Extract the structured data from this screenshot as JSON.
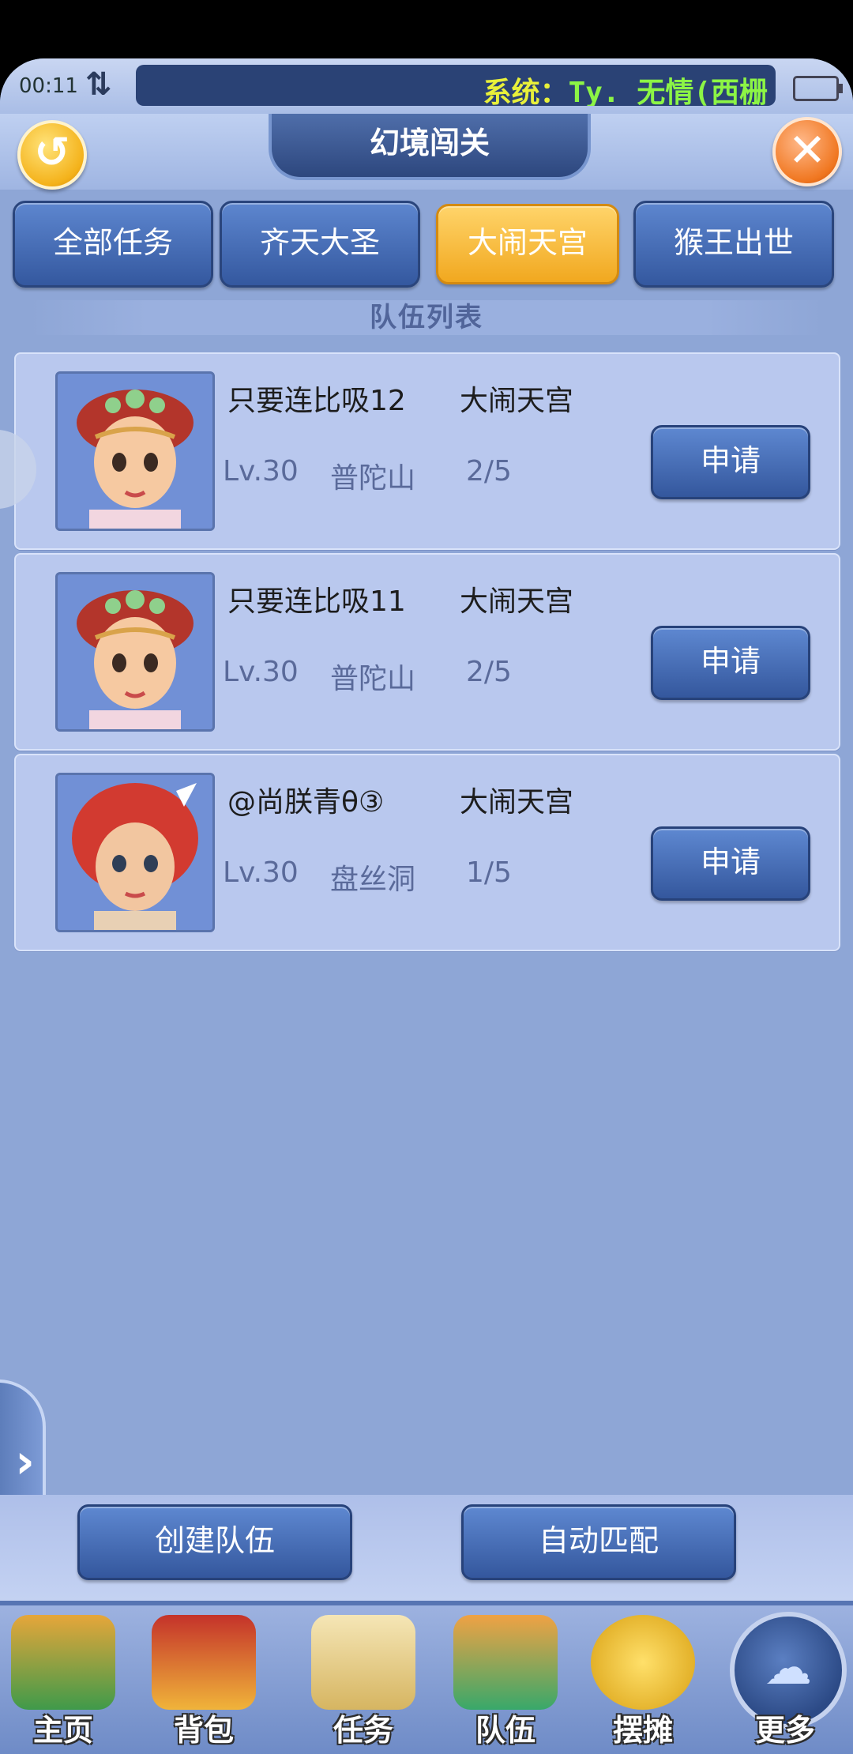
{
  "status_bar": {
    "time": "00:11",
    "net_icon": "updown-arrows-icon",
    "system_label": "系统：",
    "system_message": "Ty. 无情(西栅",
    "battery_icon": "battery-icon"
  },
  "header": {
    "title": "幻境闯关",
    "back_icon": "back-arrow-icon",
    "close_icon": "close-icon"
  },
  "tabs": [
    {
      "label": "全部任务",
      "active": false
    },
    {
      "label": "齐天大圣",
      "active": false
    },
    {
      "label": "大闹天宫",
      "active": true
    },
    {
      "label": "猴王出世",
      "active": false
    }
  ],
  "section_title": "队伍列表",
  "teams": [
    {
      "name": "只要连比吸12",
      "activity": "大闹天宫",
      "level": "Lv.30",
      "school": "普陀山",
      "count": "2/5",
      "apply_label": "申请"
    },
    {
      "name": "只要连比吸11",
      "activity": "大闹天宫",
      "level": "Lv.30",
      "school": "普陀山",
      "count": "2/5",
      "apply_label": "申请"
    },
    {
      "name": "@尚朕青θ③",
      "activity": "大闹天宫",
      "level": "Lv.30",
      "school": "盘丝洞",
      "count": "1/5",
      "apply_label": "申请"
    }
  ],
  "actions": {
    "create_team": "创建队伍",
    "auto_match": "自动匹配"
  },
  "nav": [
    {
      "label": "主页",
      "icon": "home-pavilion-icon"
    },
    {
      "label": "背包",
      "icon": "treasure-chest-icon"
    },
    {
      "label": "任务",
      "icon": "scroll-icon"
    },
    {
      "label": "队伍",
      "icon": "team-icon"
    },
    {
      "label": "摆摊",
      "icon": "coin-icon"
    },
    {
      "label": "更多",
      "icon": "more-cloud-icon"
    }
  ],
  "colors": {
    "tab_active": "#f1a81f",
    "button_blue": "#34579d",
    "background": "#8ea6d6",
    "system_text": "#e8f03a"
  }
}
